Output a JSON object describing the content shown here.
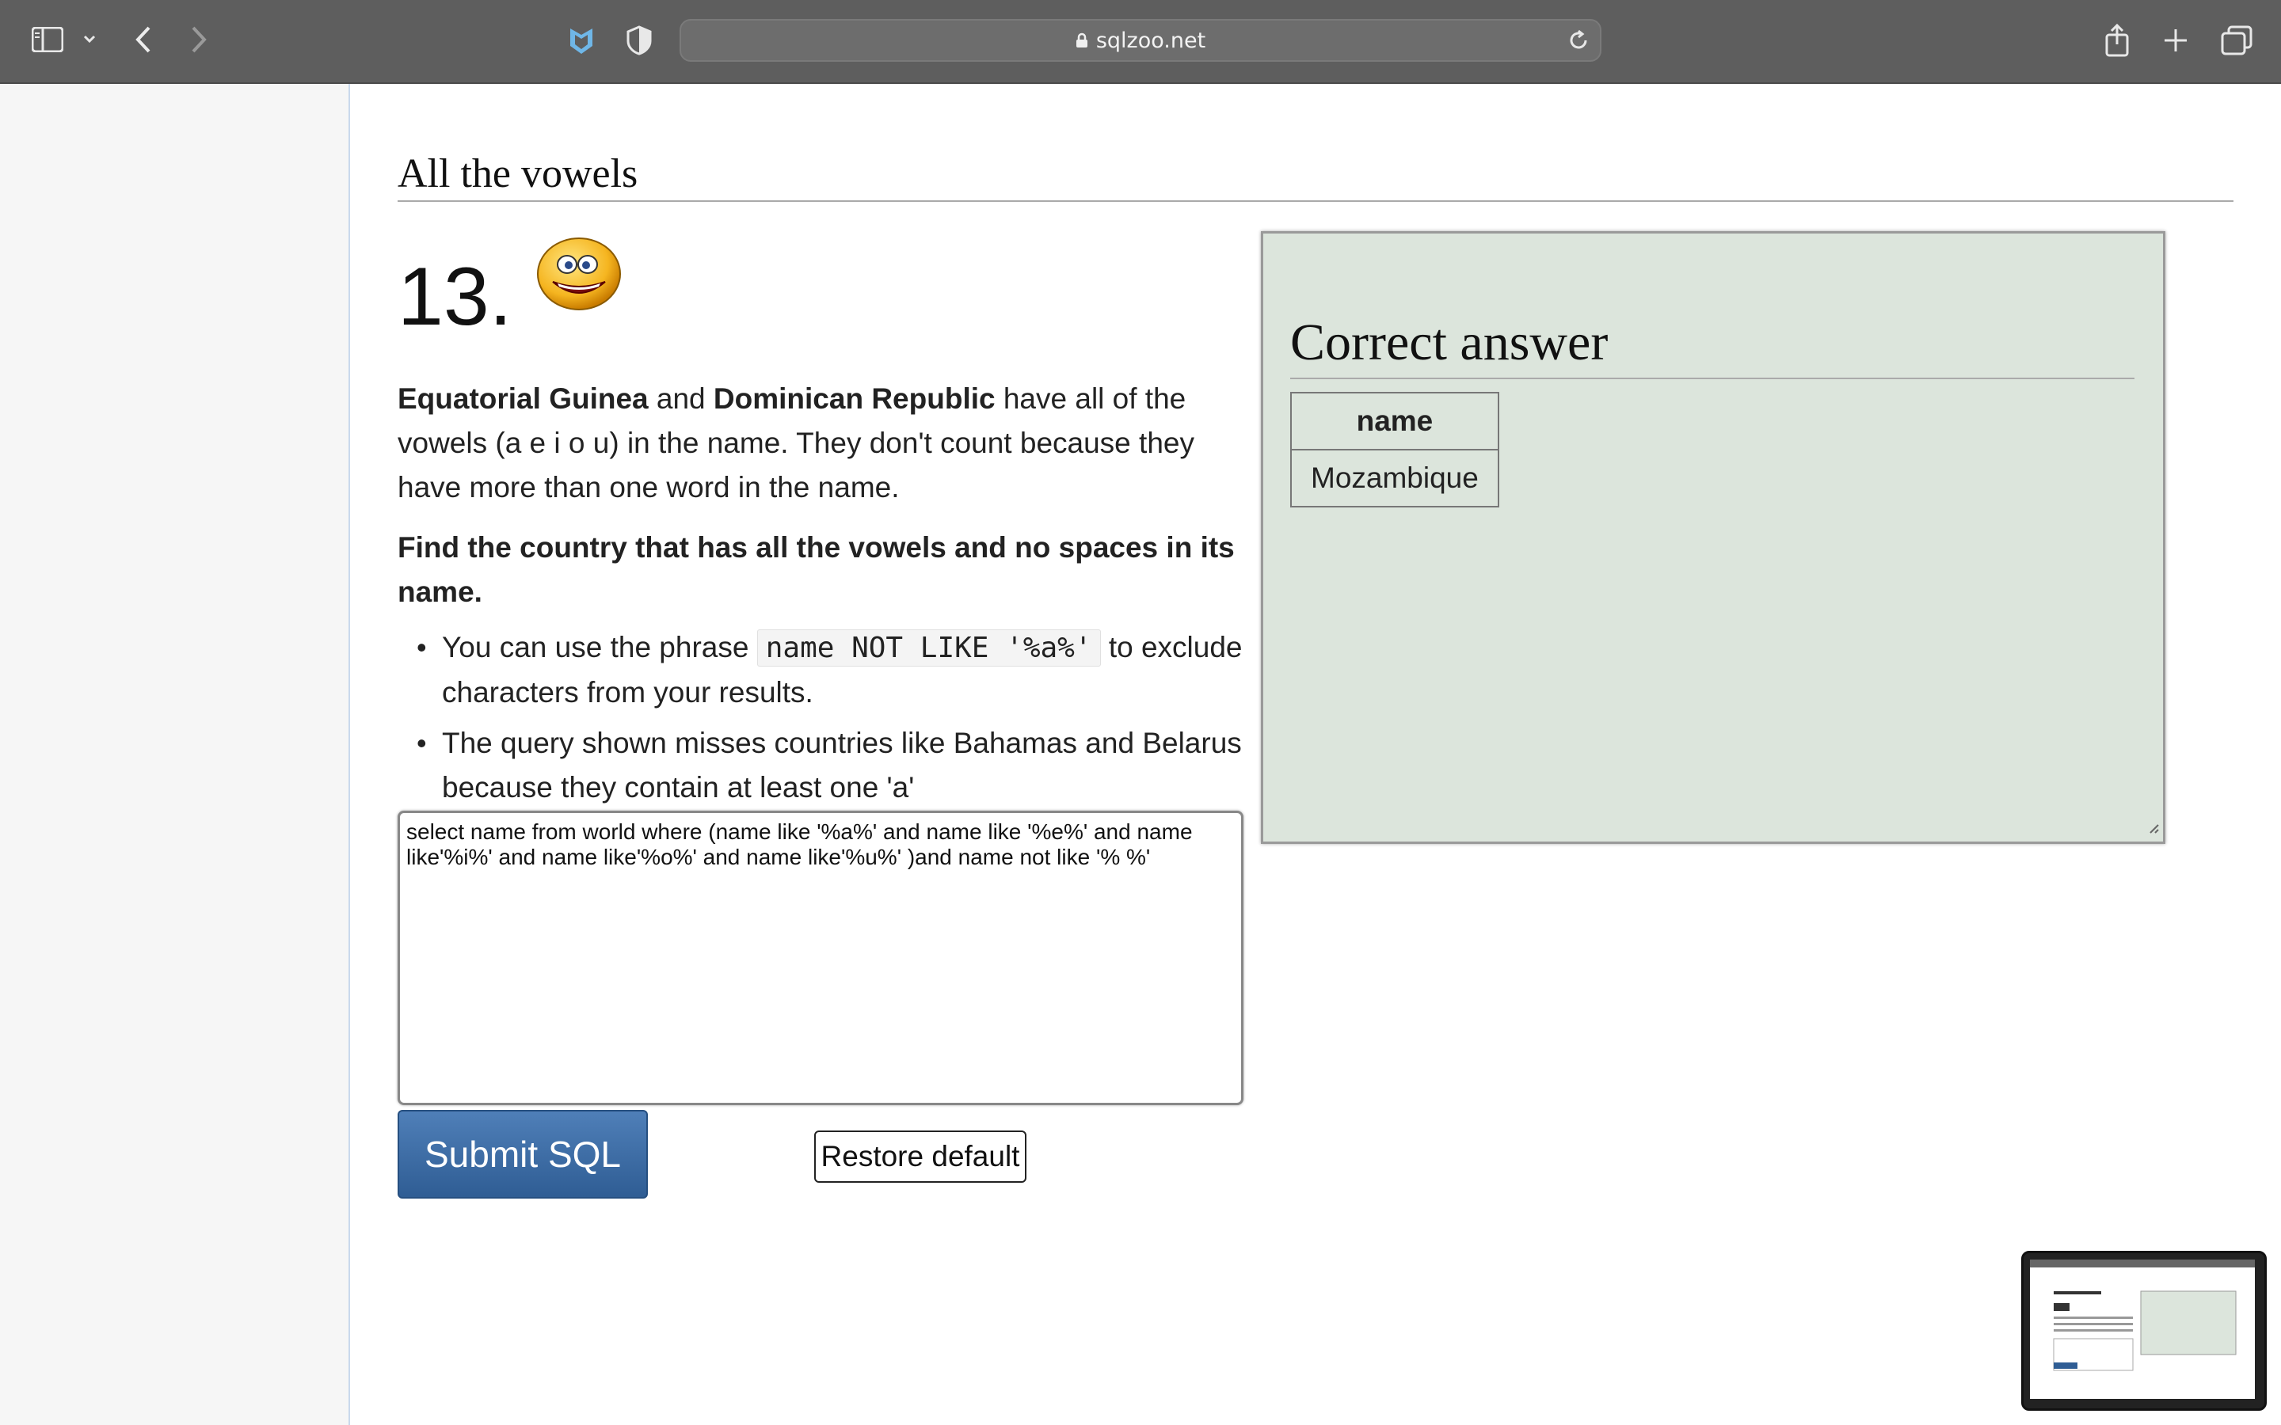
{
  "browser": {
    "url": "sqlzoo.net",
    "icons": {
      "sidebar": "sidebar-icon",
      "chevron": "chevron-down-icon",
      "back": "back-arrow-icon",
      "forward": "forward-arrow-icon",
      "extension1": "extension-shield-icon",
      "extension2": "privacy-shield-icon",
      "reload": "reload-icon",
      "share": "share-icon",
      "new_tab": "plus-icon",
      "tabs": "tabs-overview-icon"
    }
  },
  "page": {
    "section_title": "All the vowels",
    "question_number": "13.",
    "intro": {
      "country1": "Equatorial Guinea",
      "and": "and",
      "country2": "Dominican Republic",
      "rest": "have all of the vowels (a e i o u) in the name. They don't count because they have more than one word in the name."
    },
    "task": "Find the country that has all the vowels and no spaces in its name.",
    "bullets": [
      {
        "before": "You can use the phrase",
        "code": "name NOT LIKE '%a%'",
        "after": "to exclude characters from your results."
      },
      {
        "text": "The query shown misses countries like Bahamas and Belarus because they contain at least one 'a'"
      }
    ],
    "sql": "select name from world where (name like '%a%' and name like '%e%' and name like'%i%' and name like'%o%' and name like'%u%' )and name not like '% %'",
    "submit_label": "Submit SQL",
    "restore_label": "Restore default"
  },
  "answer": {
    "title": "Correct answer",
    "header": "name",
    "rows": [
      "Mozambique"
    ]
  }
}
